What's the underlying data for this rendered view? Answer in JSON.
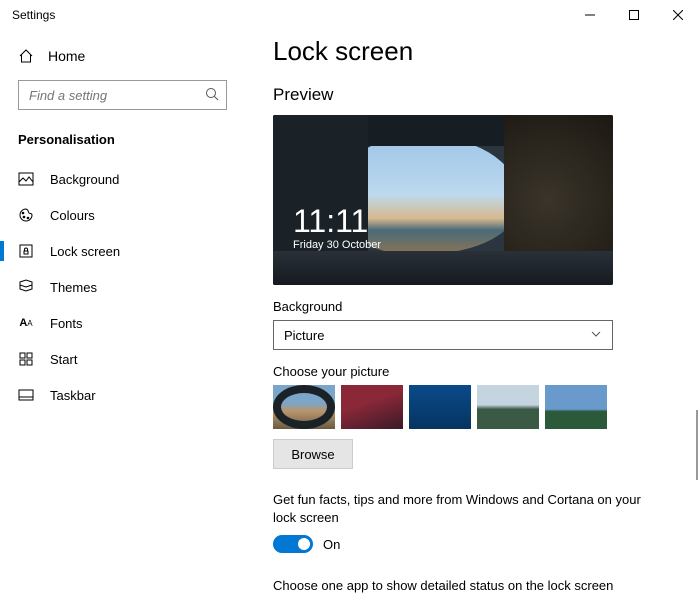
{
  "window": {
    "title": "Settings"
  },
  "sidebar": {
    "home": "Home",
    "search_placeholder": "Find a setting",
    "section": "Personalisation",
    "items": [
      {
        "label": "Background"
      },
      {
        "label": "Colours"
      },
      {
        "label": "Lock screen"
      },
      {
        "label": "Themes"
      },
      {
        "label": "Fonts"
      },
      {
        "label": "Start"
      },
      {
        "label": "Taskbar"
      }
    ]
  },
  "main": {
    "title": "Lock screen",
    "preview_label": "Preview",
    "clock_time": "11:11",
    "clock_date": "Friday 30 October",
    "background_label": "Background",
    "background_value": "Picture",
    "choose_picture_label": "Choose your picture",
    "browse_label": "Browse",
    "fun_facts_text": "Get fun facts, tips and more from Windows and Cortana on your lock screen",
    "fun_facts_state": "On",
    "detailed_status_label": "Choose one app to show detailed status on the lock screen"
  }
}
